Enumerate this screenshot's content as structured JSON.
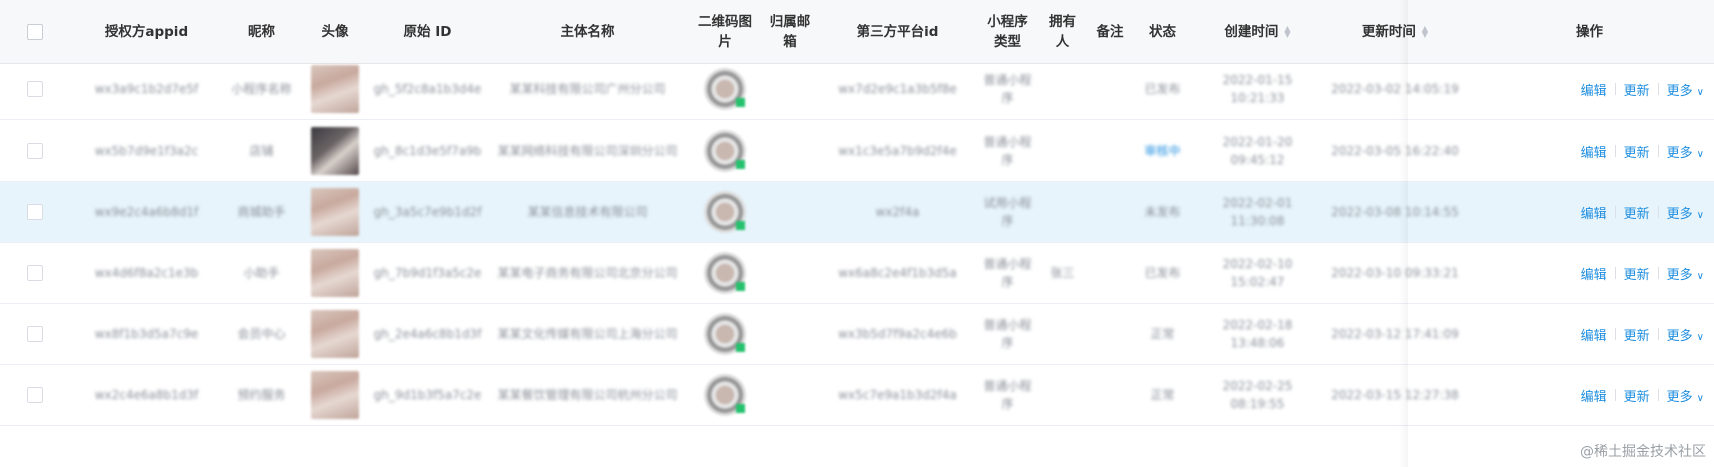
{
  "table": {
    "headers": {
      "appid": "授权方appid",
      "nickname": "昵称",
      "avatar": "头像",
      "original_id": "原始 ID",
      "subject": "主体名称",
      "qr": "二维码图片",
      "mailbox": "归属邮箱",
      "platform_id": "第三方平台id",
      "type": "小程序类型",
      "owner": "拥有人",
      "remark": "备注",
      "status": "状态",
      "created": "创建时间",
      "updated": "更新时间",
      "actions": "操作"
    },
    "action_labels": {
      "edit": "编辑",
      "update": "更新",
      "more": "更多"
    },
    "rows": [
      {
        "appid": "wx3a9c1b2d7e5f",
        "nickname": "小程序名称",
        "original_id": "gh_5f2c8a1b3d4e",
        "subject": "某某科技有限公司广州分公司",
        "platform_id": "wx7d2e9c1a3b5f8e",
        "type": "普通小程序",
        "owner": "",
        "remark": "",
        "status": "已发布",
        "created": "2022-01-15 10:21:33",
        "updated": "2022-03-02 14:05:19"
      },
      {
        "appid": "wx5b7d9e1f3a2c",
        "nickname": "店铺",
        "original_id": "gh_8c1d3e5f7a9b",
        "subject": "某某网络科技有限公司深圳分公司",
        "platform_id": "wx1c3e5a7b9d2f4e",
        "type": "普通小程序",
        "owner": "",
        "remark": "",
        "status": "审核中",
        "created": "2022-01-20 09:45:12",
        "updated": "2022-03-05 16:22:40"
      },
      {
        "appid": "wx9e2c4a6b8d1f",
        "nickname": "商城助手",
        "original_id": "gh_3a5c7e9b1d2f",
        "subject": "某某信息技术有限公司",
        "platform_id": "wx2f4a",
        "type": "试用小程序",
        "owner": "",
        "remark": "",
        "status": "未发布",
        "created": "2022-02-01 11:30:08",
        "updated": "2022-03-08 10:14:55"
      },
      {
        "appid": "wx4d6f8a2c1e3b",
        "nickname": "小助手",
        "original_id": "gh_7b9d1f3a5c2e",
        "subject": "某某电子商务有限公司北京分公司",
        "platform_id": "wx6a8c2e4f1b3d5a",
        "type": "普通小程序",
        "owner": "张三",
        "remark": "",
        "status": "已发布",
        "created": "2022-02-10 15:02:47",
        "updated": "2022-03-10 09:33:21"
      },
      {
        "appid": "wx8f1b3d5a7c9e",
        "nickname": "会员中心",
        "original_id": "gh_2e4a6c8b1d3f",
        "subject": "某某文化传媒有限公司上海分公司",
        "platform_id": "wx3b5d7f9a2c4e6b",
        "type": "普通小程序",
        "owner": "",
        "remark": "",
        "status": "正常",
        "created": "2022-02-18 13:48:06",
        "updated": "2022-03-12 17:41:09"
      },
      {
        "appid": "wx2c4e6a8b1d3f",
        "nickname": "预约服务",
        "original_id": "gh_9d1b3f5a7c2e",
        "subject": "某某餐饮管理有限公司杭州分公司",
        "platform_id": "wx5c7e9a1b3d2f4a",
        "type": "普通小程序",
        "owner": "",
        "remark": "",
        "status": "正常",
        "created": "2022-02-25 08:19:55",
        "updated": "2022-03-15 12:27:38"
      }
    ]
  },
  "watermark": "@稀土掘金技术社区",
  "colors": {
    "link": "#1f8ee0",
    "selected_row": "#e7f4fb",
    "header_bg": "#f7f8fa"
  }
}
